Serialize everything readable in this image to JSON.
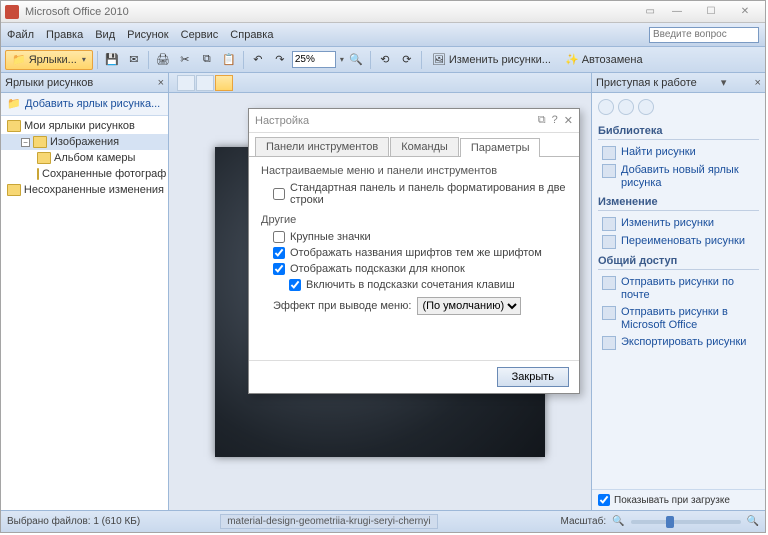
{
  "window": {
    "title": "Microsoft Office 2010"
  },
  "menubar": {
    "items": [
      "Файл",
      "Правка",
      "Вид",
      "Рисунок",
      "Сервис",
      "Справка"
    ],
    "ask_placeholder": "Введите вопрос"
  },
  "toolbar": {
    "labels_tab": "Ярлыки...",
    "zoom": "25%",
    "change_pics": "Изменить рисунки...",
    "autoreplace": "Автозамена"
  },
  "left": {
    "title": "Ярлыки рисунков",
    "add_link": "Добавить ярлык рисунка...",
    "tree": {
      "root": "Мои ярлыки рисунков",
      "folder": "Изображения",
      "children": [
        "Альбом камеры",
        "Сохраненные фотограф"
      ],
      "unsaved": "Несохраненные изменения"
    }
  },
  "right": {
    "title": "Приступая к работе",
    "lib": "Библиотека",
    "lib_links": [
      "Найти рисунки",
      "Добавить новый ярлык рисунка"
    ],
    "edit": "Изменение",
    "edit_links": [
      "Изменить рисунки",
      "Переименовать рисунки"
    ],
    "share": "Общий доступ",
    "share_links": [
      "Отправить рисунки по почте",
      "Отправить рисунки в Microsoft Office",
      "Экспортировать рисунки"
    ],
    "show_on_load": "Показывать при загрузке"
  },
  "status": {
    "selected": "Выбрано файлов: 1 (610 КБ)",
    "filename": "material-design-geometriia-krugi-seryi-chernyi",
    "scale_label": "Масштаб:"
  },
  "dialog": {
    "title": "Настройка",
    "tabs": [
      "Панели инструментов",
      "Команды",
      "Параметры"
    ],
    "grp1": "Настраиваемые меню и панели инструментов",
    "opt1": "Стандартная панель и панель форматирования в две строки",
    "grp2": "Другие",
    "opt2": "Крупные значки",
    "opt3": "Отображать названия шрифтов тем же шрифтом",
    "opt4": "Отображать подсказки для кнопок",
    "opt5": "Включить в подсказки сочетания клавиш",
    "effect_label": "Эффект при выводе меню:",
    "effect_value": "(По умолчанию)",
    "close": "Закрыть"
  }
}
